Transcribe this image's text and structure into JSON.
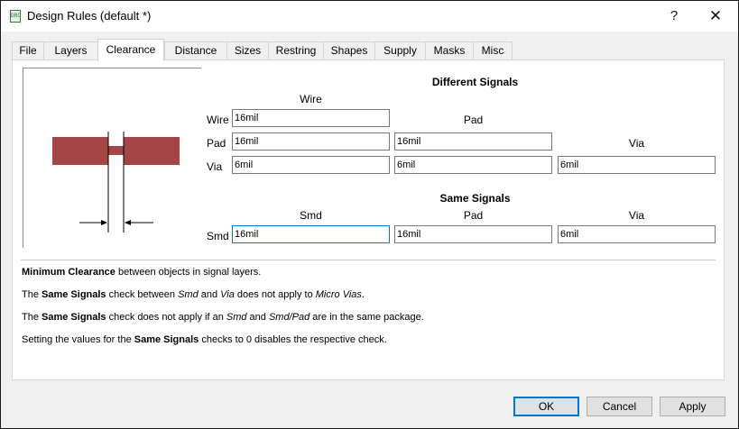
{
  "window": {
    "title": "Design Rules (default *)",
    "app_icon_text": "DRC"
  },
  "titlebar": {
    "help": "?",
    "close": "✕"
  },
  "tabs": [
    {
      "label": "File"
    },
    {
      "label": "Layers"
    },
    {
      "label": "Clearance"
    },
    {
      "label": "Distance"
    },
    {
      "label": "Sizes"
    },
    {
      "label": "Restring"
    },
    {
      "label": "Shapes"
    },
    {
      "label": "Supply"
    },
    {
      "label": "Masks"
    },
    {
      "label": "Misc"
    }
  ],
  "active_tab": "Clearance",
  "diff": {
    "title": "Different Signals",
    "col_wire": "Wire",
    "col_pad": "Pad",
    "col_via": "Via",
    "row_wire": "Wire",
    "row_pad": "Pad",
    "row_via": "Via",
    "wire_wire": "16mil",
    "pad_wire": "16mil",
    "pad_pad": "16mil",
    "via_wire": "6mil",
    "via_pad": "6mil",
    "via_via": "6mil"
  },
  "same": {
    "title": "Same Signals",
    "col_smd": "Smd",
    "col_pad": "Pad",
    "col_via": "Via",
    "row_smd": "Smd",
    "smd_smd": "16mil",
    "smd_pad": "16mil",
    "smd_via": "6mil"
  },
  "desc": {
    "l1_b": "Minimum Clearance",
    "l1_t": " between objects in signal layers.",
    "l2_a": "The ",
    "l2_b": "Same Signals",
    "l2_c": " check between ",
    "l2_i1": "Smd",
    "l2_d": " and ",
    "l2_i2": "Via",
    "l2_e": " does not apply to ",
    "l2_i3": "Micro Vias",
    "l2_f": ".",
    "l3_a": "The ",
    "l3_b": "Same Signals",
    "l3_c": " check does not apply if an ",
    "l3_i1": "Smd",
    "l3_d": " and ",
    "l3_i2": "Smd/Pad",
    "l3_e": " are in the same package.",
    "l4_a": "Setting the values for the ",
    "l4_b": "Same Signals",
    "l4_c": " checks to 0 disables the respective check."
  },
  "buttons": {
    "ok": "OK",
    "cancel": "Cancel",
    "apply": "Apply"
  },
  "colors": {
    "accent": "#0078d7",
    "wire_fill": "#a64545"
  }
}
